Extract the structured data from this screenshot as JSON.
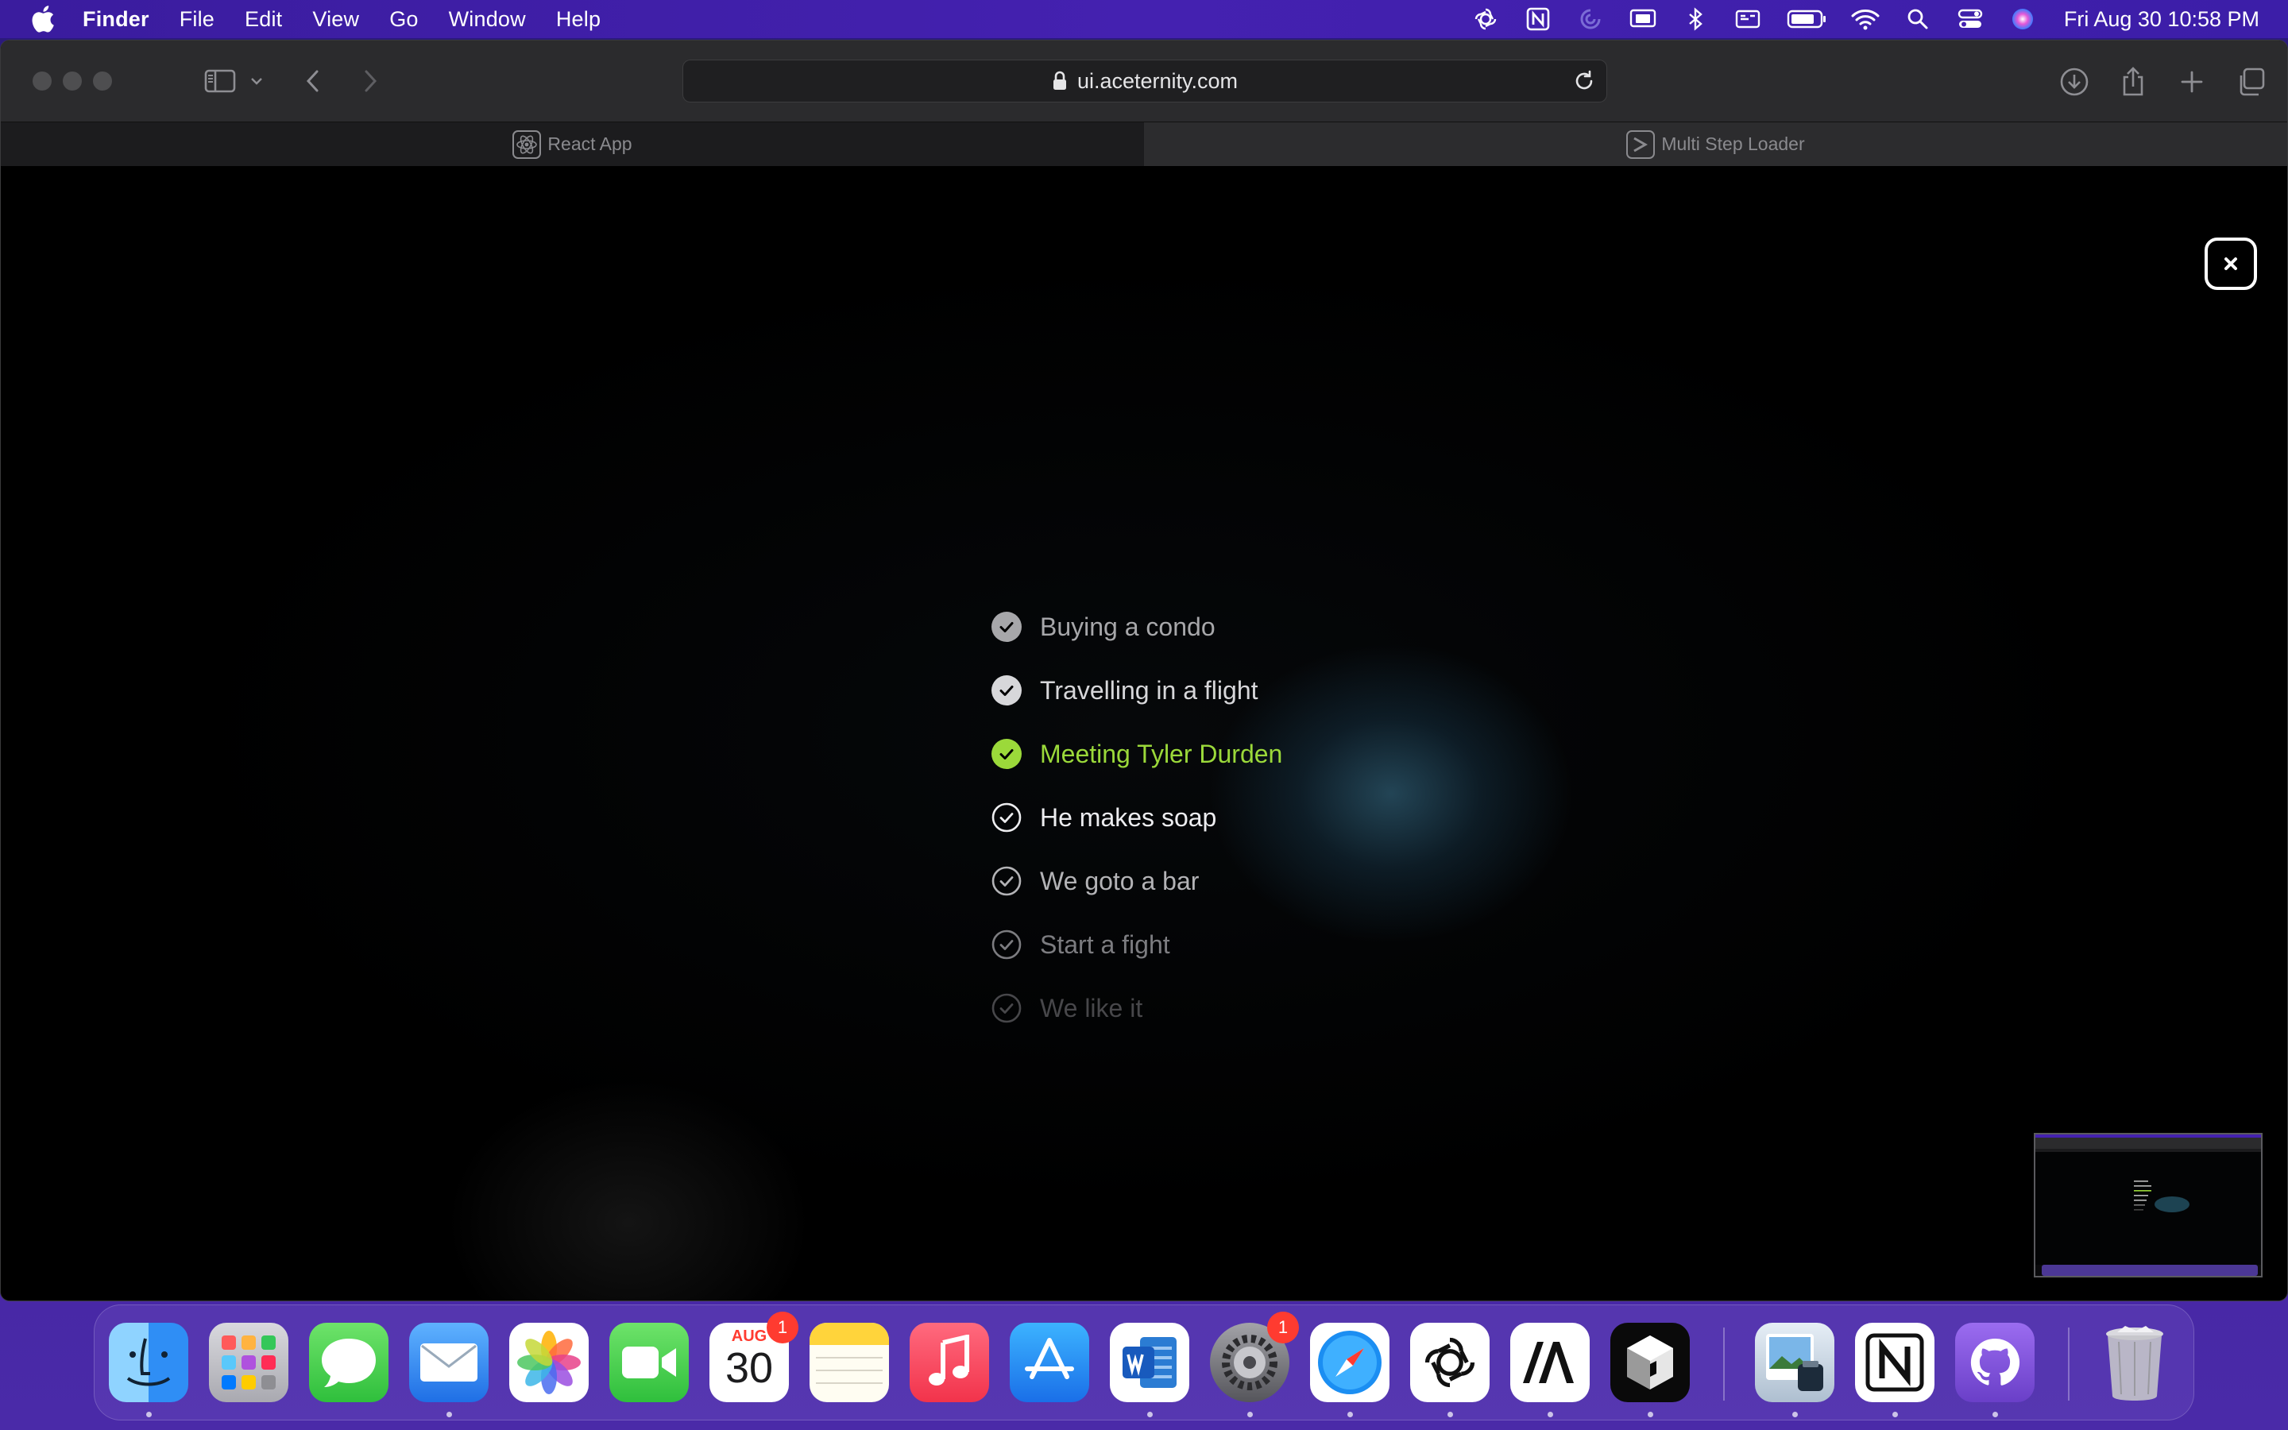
{
  "menubar": {
    "app_name": "Finder",
    "items": [
      "File",
      "Edit",
      "View",
      "Go",
      "Window",
      "Help"
    ],
    "status_icons": [
      "chatgpt-icon",
      "notion-icon",
      "arc-icon",
      "screen-mirror-icon",
      "bluetooth-icon",
      "display-icon",
      "battery-icon",
      "wifi-icon",
      "search-icon",
      "control-center-icon",
      "siri-icon"
    ],
    "clock": "Fri Aug 30  10:58 PM"
  },
  "browser": {
    "url": "ui.aceternity.com",
    "tabs": [
      {
        "label": "React App",
        "favicon": "react-icon",
        "active": false
      },
      {
        "label": "Multi Step Loader",
        "favicon": "aceternity-icon",
        "active": true
      }
    ]
  },
  "loader": {
    "steps": [
      {
        "label": "Buying a condo",
        "state": "done",
        "color": "#a7a7aa"
      },
      {
        "label": "Travelling in a flight",
        "state": "done",
        "color": "#d7d7da"
      },
      {
        "label": "Meeting Tyler Durden",
        "state": "current",
        "color": "#9bd93a"
      },
      {
        "label": "He makes soap",
        "state": "pending",
        "color": "#ededf0"
      },
      {
        "label": "We goto a bar",
        "state": "pending",
        "color": "#b3b3b6"
      },
      {
        "label": "Start a fight",
        "state": "pending",
        "color": "#7c7c80"
      },
      {
        "label": "We like it",
        "state": "pending",
        "color": "#47474a"
      }
    ]
  },
  "dock": {
    "apps": [
      {
        "name": "finder",
        "running": true
      },
      {
        "name": "launchpad",
        "running": false
      },
      {
        "name": "messages",
        "running": false
      },
      {
        "name": "mail",
        "running": true
      },
      {
        "name": "photos",
        "running": false
      },
      {
        "name": "facetime",
        "running": false
      },
      {
        "name": "calendar",
        "running": false,
        "badge": "1",
        "month": "AUG",
        "day": "30"
      },
      {
        "name": "notes",
        "running": false
      },
      {
        "name": "music",
        "running": false
      },
      {
        "name": "app-store",
        "running": false
      },
      {
        "name": "word",
        "running": true
      },
      {
        "name": "system-settings",
        "running": true,
        "badge": "1"
      },
      {
        "name": "safari",
        "running": true
      },
      {
        "name": "chatgpt",
        "running": true
      },
      {
        "name": "anthropic",
        "running": true
      },
      {
        "name": "perplexity",
        "running": true
      },
      {
        "name": "preview",
        "running": true
      },
      {
        "name": "notion",
        "running": true
      },
      {
        "name": "github-desktop",
        "running": true
      },
      {
        "name": "trash",
        "running": false
      }
    ]
  }
}
